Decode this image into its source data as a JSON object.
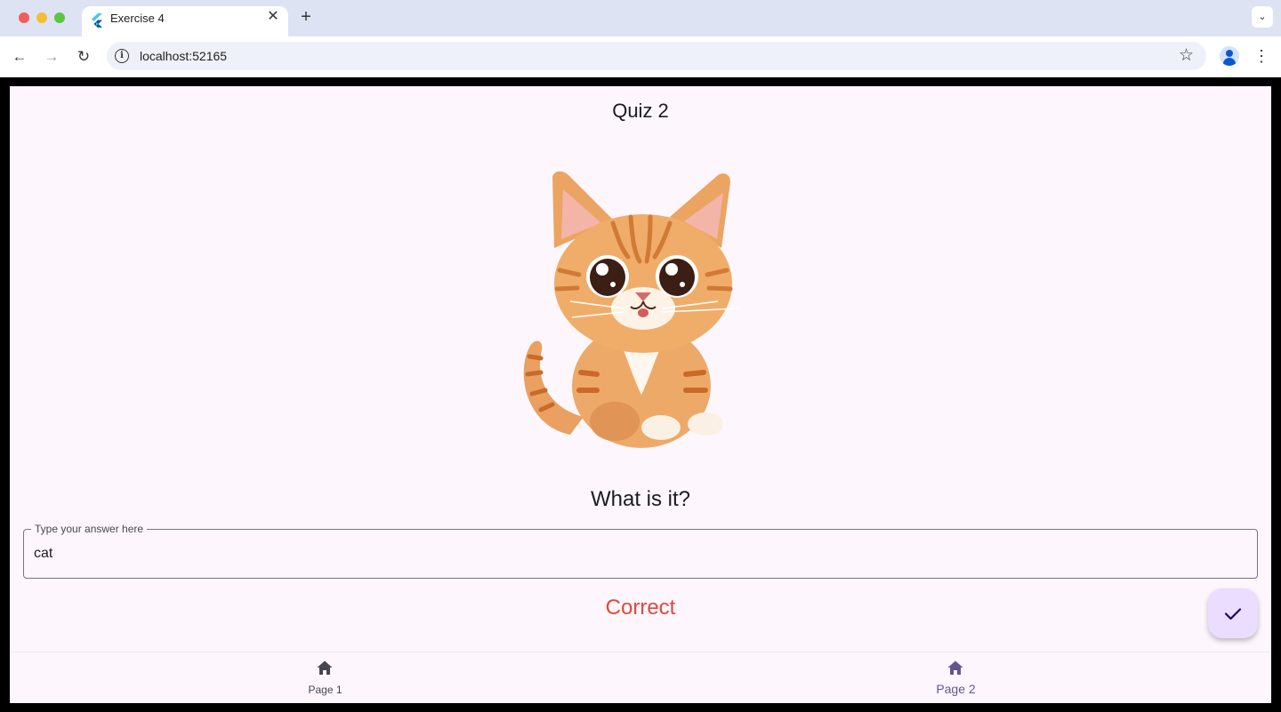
{
  "browser": {
    "tab_title": "Exercise 4",
    "tab_close": "✕",
    "new_tab": "+",
    "tab_menu": "⌄",
    "url": "localhost:52165",
    "nav": {
      "back": "←",
      "forward": "→",
      "reload": "↻"
    },
    "star": "☆",
    "menu": "⋮"
  },
  "app": {
    "title": "Quiz 2",
    "question": "What is it?",
    "answer_field": {
      "label": "Type your answer here",
      "value": "cat"
    },
    "result": "Correct",
    "colors": {
      "result": "#e0483c",
      "fab_bg": "#eaddff",
      "selected_nav": "#65558f"
    },
    "nav_items": [
      {
        "label": "Page 1",
        "icon": "home-icon",
        "selected": false
      },
      {
        "label": "Page 2",
        "icon": "home-icon",
        "selected": true
      }
    ]
  }
}
